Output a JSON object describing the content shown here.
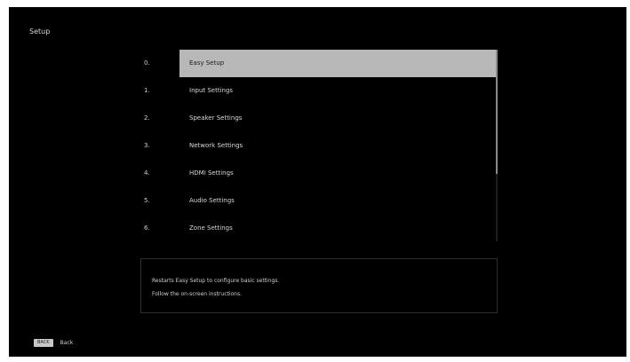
{
  "header": {
    "title": "Setup"
  },
  "menu": {
    "items": [
      {
        "number": "0.",
        "label": "Easy Setup",
        "selected": true
      },
      {
        "number": "1.",
        "label": "Input Settings",
        "selected": false
      },
      {
        "number": "2.",
        "label": "Speaker Settings",
        "selected": false
      },
      {
        "number": "3.",
        "label": "Network Settings",
        "selected": false
      },
      {
        "number": "4.",
        "label": "HDMI Settings",
        "selected": false
      },
      {
        "number": "5.",
        "label": "Audio Settings",
        "selected": false
      },
      {
        "number": "6.",
        "label": "Zone Settings",
        "selected": false
      }
    ]
  },
  "info": {
    "line1": "Restarts Easy Setup to configure basic settings.",
    "line2": "Follow the on-screen instructions."
  },
  "footer": {
    "back_key": "BACK",
    "back_label": "Back"
  },
  "colors": {
    "background": "#000000",
    "selection": "#b8b8b8"
  }
}
